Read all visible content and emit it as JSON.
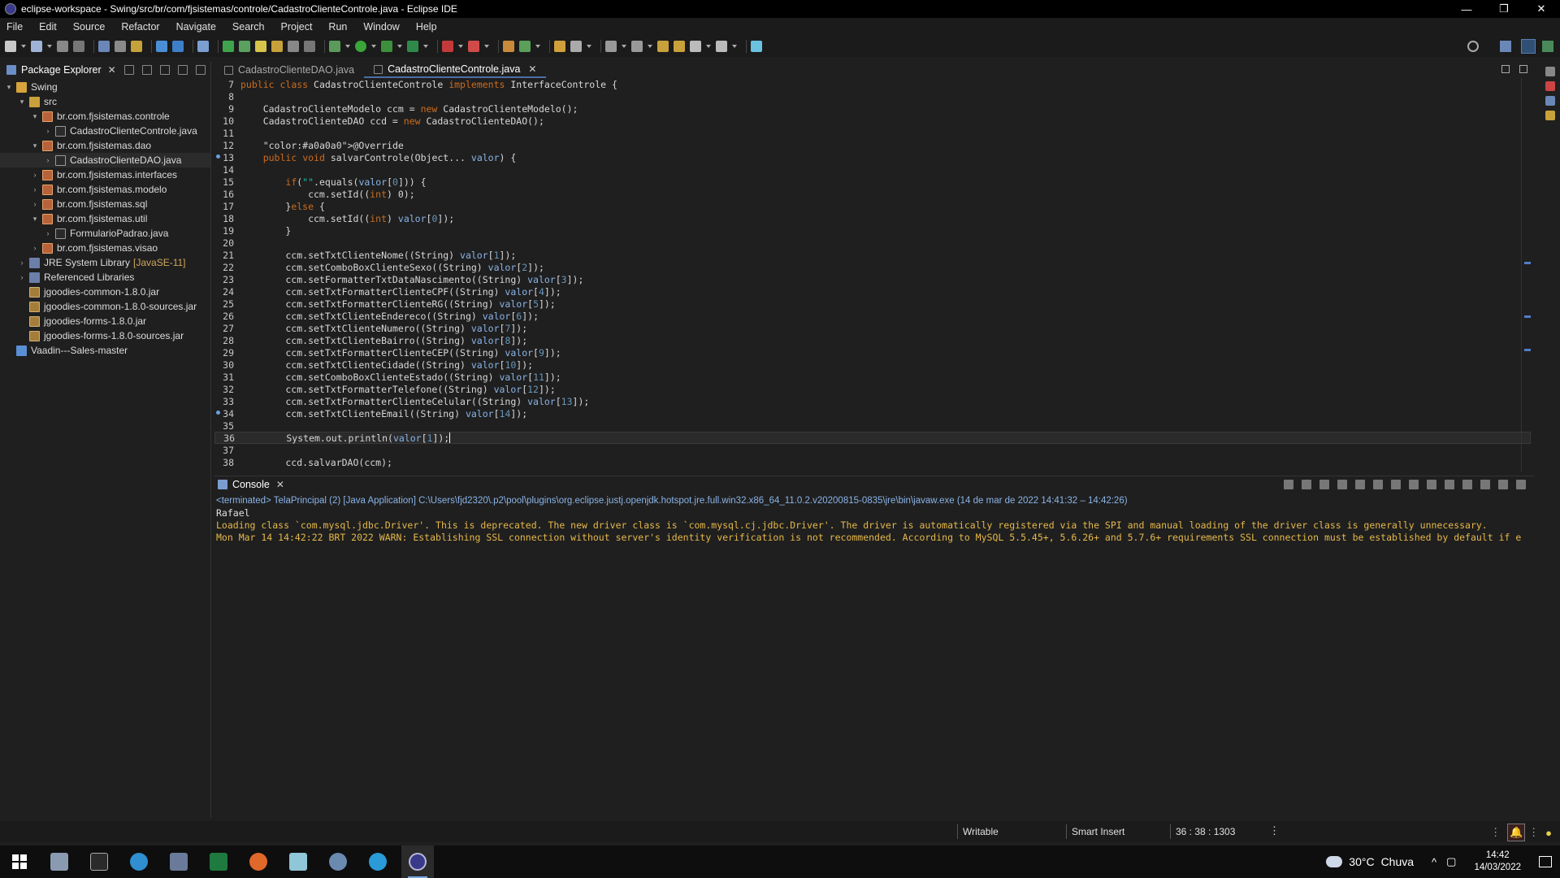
{
  "window": {
    "title": "eclipse-workspace - Swing/src/br/com/fjsistemas/controle/CadastroClienteControle.java - Eclipse IDE",
    "minimize": "—",
    "restore": "❐",
    "close": "✕"
  },
  "menu": [
    "File",
    "Edit",
    "Source",
    "Refactor",
    "Navigate",
    "Search",
    "Project",
    "Run",
    "Window",
    "Help"
  ],
  "explorer": {
    "title": "Package Explorer",
    "close": "✕",
    "tree": [
      {
        "label": "Swing",
        "indent": 0,
        "arrow": "▾",
        "icon": "project"
      },
      {
        "label": "src",
        "indent": 1,
        "arrow": "▾",
        "icon": "folder"
      },
      {
        "label": "br.com.fjsistemas.controle",
        "indent": 2,
        "arrow": "▾",
        "icon": "pkg"
      },
      {
        "label": "CadastroClienteControle.java",
        "indent": 3,
        "arrow": "›",
        "icon": "java"
      },
      {
        "label": "br.com.fjsistemas.dao",
        "indent": 2,
        "arrow": "▾",
        "icon": "pkg"
      },
      {
        "label": "CadastroClienteDAO.java",
        "indent": 3,
        "arrow": "›",
        "icon": "java",
        "selected": true
      },
      {
        "label": "br.com.fjsistemas.interfaces",
        "indent": 2,
        "arrow": "›",
        "icon": "pkg"
      },
      {
        "label": "br.com.fjsistemas.modelo",
        "indent": 2,
        "arrow": "›",
        "icon": "pkg"
      },
      {
        "label": "br.com.fjsistemas.sql",
        "indent": 2,
        "arrow": "›",
        "icon": "pkg"
      },
      {
        "label": "br.com.fjsistemas.util",
        "indent": 2,
        "arrow": "▾",
        "icon": "pkg"
      },
      {
        "label": "FormularioPadrao.java",
        "indent": 3,
        "arrow": "›",
        "icon": "java"
      },
      {
        "label": "br.com.fjsistemas.visao",
        "indent": 2,
        "arrow": "›",
        "icon": "pkg"
      },
      {
        "label": "JRE System Library",
        "suffix": "[JavaSE-11]",
        "indent": 1,
        "arrow": "›",
        "icon": "lib"
      },
      {
        "label": "Referenced Libraries",
        "indent": 1,
        "arrow": "›",
        "icon": "lib"
      },
      {
        "label": "jgoodies-common-1.8.0.jar",
        "indent": 1,
        "arrow": "",
        "icon": "jar"
      },
      {
        "label": "jgoodies-common-1.8.0-sources.jar",
        "indent": 1,
        "arrow": "",
        "icon": "jar"
      },
      {
        "label": "jgoodies-forms-1.8.0.jar",
        "indent": 1,
        "arrow": "",
        "icon": "jar"
      },
      {
        "label": "jgoodies-forms-1.8.0-sources.jar",
        "indent": 1,
        "arrow": "",
        "icon": "jar"
      },
      {
        "label": "Vaadin---Sales-master",
        "indent": 0,
        "arrow": "",
        "icon": "proj2"
      }
    ]
  },
  "editor": {
    "tabs": [
      {
        "label": "CadastroClienteDAO.java",
        "active": false,
        "close": ""
      },
      {
        "label": "CadastroClienteControle.java",
        "active": true,
        "close": "✕"
      }
    ],
    "lines": [
      {
        "n": "7",
        "text": "public class CadastroClienteControle implements InterfaceControle {"
      },
      {
        "n": "8",
        "text": ""
      },
      {
        "n": "9",
        "text": "    CadastroClienteModelo ccm = new CadastroClienteModelo();"
      },
      {
        "n": "10",
        "text": "    CadastroClienteDAO ccd = new CadastroClienteDAO();"
      },
      {
        "n": "11",
        "text": ""
      },
      {
        "n": "12",
        "text": "    @Override"
      },
      {
        "n": "13",
        "text": "    public void salvarControle(Object... valor) {",
        "marker": true
      },
      {
        "n": "14",
        "text": ""
      },
      {
        "n": "15",
        "text": "        if(\"\".equals(valor[0])) {"
      },
      {
        "n": "16",
        "text": "            ccm.setId((int) 0);"
      },
      {
        "n": "17",
        "text": "        }else {"
      },
      {
        "n": "18",
        "text": "            ccm.setId((int) valor[0]);"
      },
      {
        "n": "19",
        "text": "        }"
      },
      {
        "n": "20",
        "text": ""
      },
      {
        "n": "21",
        "text": "        ccm.setTxtClienteNome((String) valor[1]);"
      },
      {
        "n": "22",
        "text": "        ccm.setComboBoxClienteSexo((String) valor[2]);"
      },
      {
        "n": "23",
        "text": "        ccm.setFormatterTxtDataNascimento((String) valor[3]);"
      },
      {
        "n": "24",
        "text": "        ccm.setTxtFormatterClienteCPF((String) valor[4]);"
      },
      {
        "n": "25",
        "text": "        ccm.setTxtFormatterClienteRG((String) valor[5]);"
      },
      {
        "n": "26",
        "text": "        ccm.setTxtClienteEndereco((String) valor[6]);"
      },
      {
        "n": "27",
        "text": "        ccm.setTxtClienteNumero((String) valor[7]);"
      },
      {
        "n": "28",
        "text": "        ccm.setTxtClienteBairro((String) valor[8]);"
      },
      {
        "n": "29",
        "text": "        ccm.setTxtFormatterClienteCEP((String) valor[9]);"
      },
      {
        "n": "30",
        "text": "        ccm.setTxtClienteCidade((String) valor[10]);"
      },
      {
        "n": "31",
        "text": "        ccm.setComboBoxClienteEstado((String) valor[11]);"
      },
      {
        "n": "32",
        "text": "        ccm.setTxtFormatterTelefone((String) valor[12]);"
      },
      {
        "n": "33",
        "text": "        ccm.setTxtFormatterClienteCelular((String) valor[13]);"
      },
      {
        "n": "34",
        "text": "        ccm.setTxtClienteEmail((String) valor[14]);",
        "marker": true
      },
      {
        "n": "35",
        "text": ""
      },
      {
        "n": "36",
        "text": "        System.out.println(valor[1]);",
        "current": true
      },
      {
        "n": "37",
        "text": ""
      },
      {
        "n": "38",
        "text": "        ccd.salvarDAO(ccm);"
      }
    ]
  },
  "console": {
    "title": "Console",
    "close": "✕",
    "status": "<terminated> TelaPrincipal (2) [Java Application] C:\\Users\\fjd2320\\.p2\\pool\\plugins\\org.eclipse.justj.openjdk.hotspot.jre.full.win32.x86_64_11.0.2.v20200815-0835\\jre\\bin\\javaw.exe  (14 de mar de 2022 14:41:32 – 14:42:26)",
    "output": [
      {
        "text": "Rafael",
        "kind": "normal"
      },
      {
        "text": "Loading class `com.mysql.jdbc.Driver'. This is deprecated. The new driver class is `com.mysql.cj.jdbc.Driver'. The driver is automatically registered via the SPI and manual loading of the driver class is generally unnecessary.",
        "kind": "err"
      },
      {
        "text": "Mon Mar 14 14:42:22 BRT 2022 WARN: Establishing SSL connection without server's identity verification is not recommended. According to MySQL 5.5.45+, 5.6.26+ and 5.7.6+ requirements SSL connection must be established by default if e",
        "kind": "err"
      }
    ]
  },
  "statusbar": {
    "writable": "Writable",
    "insert_mode": "Smart Insert",
    "position": "36 : 38 : 1303",
    "more": "⋮"
  },
  "taskbar": {
    "weather_temp": "30°C",
    "weather_text": "Chuva",
    "tray_chevron": "^",
    "time": "14:42",
    "date": "14/03/2022"
  },
  "colors": {
    "keyword": "#cc6c1d",
    "annotation": "#a0a0a0",
    "string": "#17c6a3",
    "number": "#6897bb",
    "accent": "#4a6fa5"
  }
}
